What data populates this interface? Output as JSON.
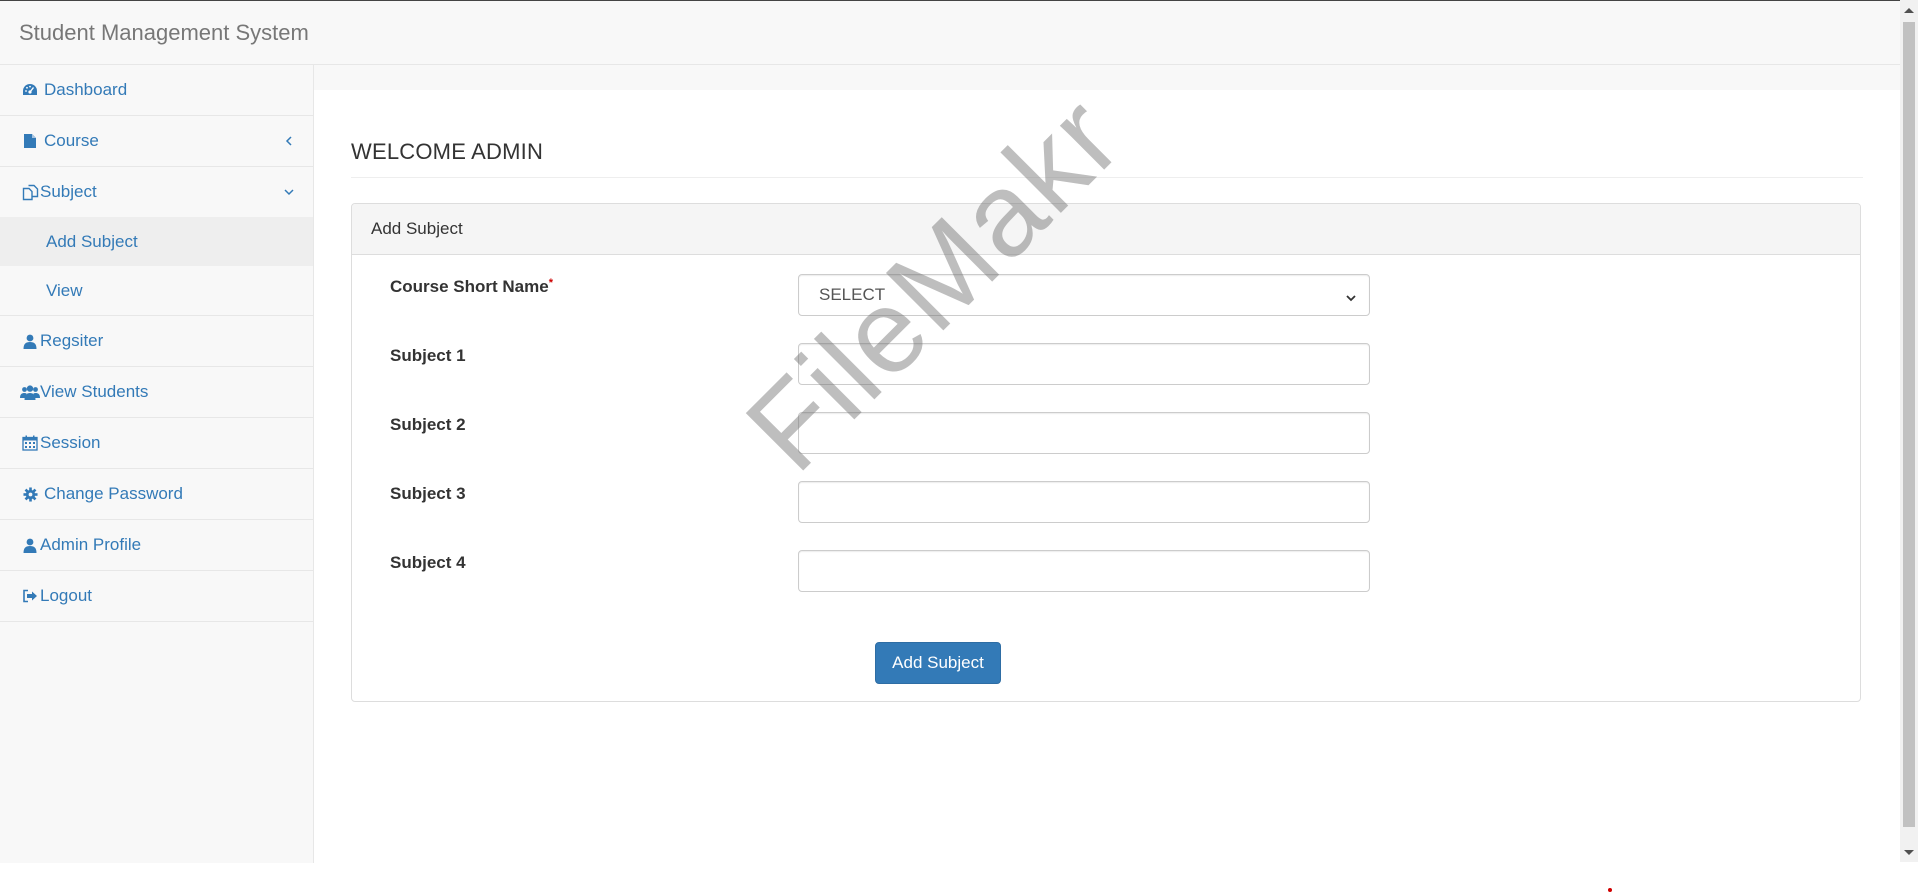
{
  "app": {
    "brand": "Student Management System"
  },
  "sidebar": {
    "items": [
      {
        "label": "Dashboard",
        "icon": "dashboard-icon"
      },
      {
        "label": "Course",
        "icon": "file-icon"
      },
      {
        "label": "Subject",
        "icon": "copy-icon"
      },
      {
        "label": "Regsiter",
        "icon": "user-icon"
      },
      {
        "label": "View Students",
        "icon": "users-icon"
      },
      {
        "label": "Session",
        "icon": "calendar-icon"
      },
      {
        "label": "Change Password",
        "icon": "gear-icon"
      },
      {
        "label": "Admin Profile",
        "icon": "user-icon"
      },
      {
        "label": "Logout",
        "icon": "sign-out-icon"
      }
    ],
    "subject_sub": [
      {
        "label": "Add Subject",
        "active": true
      },
      {
        "label": "View",
        "active": false
      }
    ]
  },
  "page": {
    "header": "WELCOME ADMIN"
  },
  "panel": {
    "heading": "Add Subject",
    "fields": {
      "course_label": "Course Short Name",
      "required_mark": "*",
      "course_value": "SELECT",
      "subject1_label": "Subject 1",
      "subject2_label": "Subject 2",
      "subject3_label": "Subject 3",
      "subject4_label": "Subject 4",
      "subject1_value": "",
      "subject2_value": "",
      "subject3_value": "",
      "subject4_value": ""
    },
    "submit_label": "Add Subject"
  },
  "watermark": "FileMakr",
  "colors": {
    "link": "#337ab7",
    "button": "#337ab7",
    "required": "#cc0000"
  }
}
